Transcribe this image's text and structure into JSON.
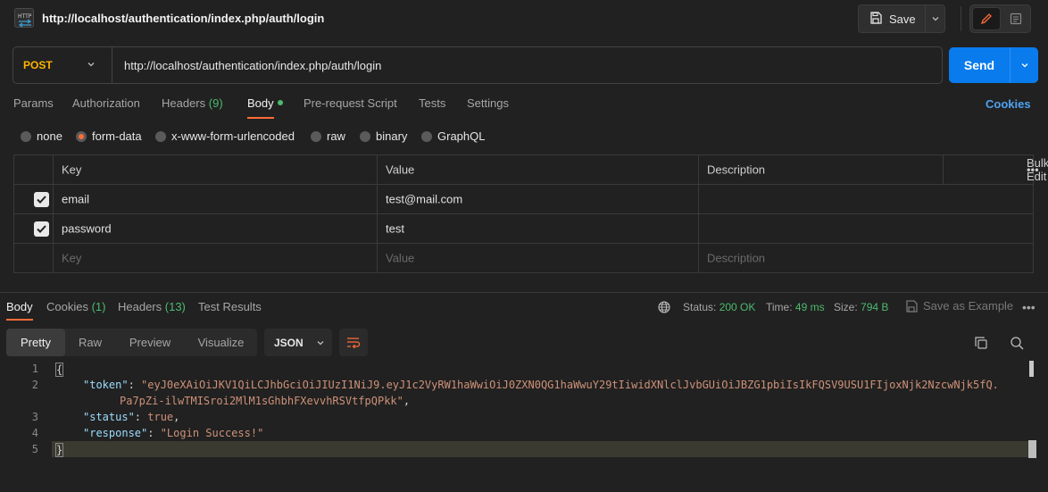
{
  "window": {
    "title": "http://localhost/authentication/index.php/auth/login",
    "save_label": "Save"
  },
  "request": {
    "method": "POST",
    "url": "http://localhost/authentication/index.php/auth/login",
    "send_label": "Send"
  },
  "request_tabs": {
    "params": "Params",
    "authorization": "Authorization",
    "headers": "Headers",
    "headers_count": "(9)",
    "body": "Body",
    "prerequest": "Pre-request Script",
    "tests": "Tests",
    "settings": "Settings",
    "cookies": "Cookies"
  },
  "body_types": {
    "none": "none",
    "form_data": "form-data",
    "urlencoded": "x-www-form-urlencoded",
    "raw": "raw",
    "binary": "binary",
    "graphql": "GraphQL",
    "selected": "form-data"
  },
  "params_table": {
    "headers": {
      "key": "Key",
      "value": "Value",
      "description": "Description",
      "bulk_edit": "Bulk Edit"
    },
    "rows": [
      {
        "key": "email",
        "value": "test@mail.com",
        "description": "",
        "checked": true
      },
      {
        "key": "password",
        "value": "test",
        "description": "",
        "checked": true
      }
    ],
    "placeholder": {
      "key": "Key",
      "value": "Value",
      "description": "Description"
    }
  },
  "response_tabs": {
    "body": "Body",
    "cookies": "Cookies",
    "cookies_count": "(1)",
    "headers": "Headers",
    "headers_count": "(13)",
    "test_results": "Test Results"
  },
  "response_meta": {
    "status_label": "Status:",
    "status_value": "200 OK",
    "time_label": "Time:",
    "time_value": "49 ms",
    "size_label": "Size:",
    "size_value": "794 B",
    "save_example": "Save as Example"
  },
  "view_tabs": {
    "pretty": "Pretty",
    "raw": "Raw",
    "preview": "Preview",
    "visualize": "Visualize",
    "format": "JSON"
  },
  "code": {
    "line_numbers": [
      "1",
      "2",
      "3",
      "4",
      "5"
    ],
    "open_brace": "{",
    "close_brace": "}",
    "token_key": "\"token\"",
    "token_value_1": "\"eyJ0eXAiOiJKV1QiLCJhbGciOiJIUzI1NiJ9.eyJ1c2VyRW1haWwiOiJ0ZXN0QG1haWwuY29tIiwidXNlclJvbGUiOiJBZG1pbiIsIkFQSV9USU1FIjoxNjk2NzcwNjk5fQ.",
    "token_value_2": "Pa7pZi-ilwTMISroi2MlM1sGhbhFXevvhRSVtfpQPkk\"",
    "status_key": "\"status\"",
    "status_value": "true",
    "response_key": "\"response\"",
    "response_value": "\"Login Success!\""
  },
  "colors": {
    "accent_orange": "#ff6c37",
    "send_blue": "#097bed",
    "method_yellow": "#ffb400",
    "success_green": "#4dba6e",
    "link_blue": "#4ea2f0"
  }
}
